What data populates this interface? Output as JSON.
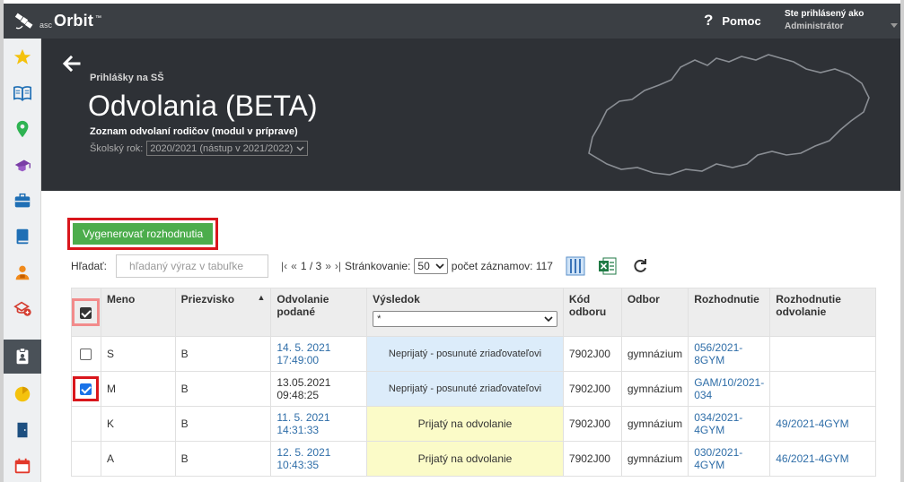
{
  "app": {
    "logo_small": "asc",
    "logo_text": "Orbit",
    "logo_tm": "™",
    "help_label": "Pomoc",
    "user_line1": "Ste prihlásený ako",
    "user_line2": "Administrátor"
  },
  "sidebar": {
    "items": [
      {
        "icon": "star-icon"
      },
      {
        "icon": "book-open-icon"
      },
      {
        "icon": "location-pin-icon"
      },
      {
        "icon": "graduation-cap-icon"
      },
      {
        "icon": "briefcase-icon"
      },
      {
        "icon": "book-icon"
      },
      {
        "icon": "student-icon"
      },
      {
        "icon": "school-add-icon"
      },
      {
        "icon": "clipboard-user-icon",
        "active": true
      },
      {
        "icon": "pie-chart-icon"
      },
      {
        "icon": "door-icon"
      },
      {
        "icon": "calendar-icon"
      }
    ]
  },
  "header": {
    "breadcrumb": "Prihlášky na SŠ",
    "title": "Odvolania (BETA)",
    "subtitle": "Zoznam odvolaní rodičov (modul v príprave)",
    "year_label": "Školský rok:",
    "year_value": "2020/2021 (nástup v 2021/2022)"
  },
  "toolbar": {
    "generate_label": "Vygenerovať rozhodnutia",
    "search_label": "Hľadať:",
    "search_placeholder": "hľadaný výraz v tabuľke",
    "pager_first": "|‹",
    "pager_prev": "«",
    "pager_current": "1 / 3",
    "pager_next": "»",
    "pager_last": "›|",
    "paging_label": "Stránkovanie:",
    "page_size": "50",
    "count_label": "počet záznamov: 117"
  },
  "table": {
    "headers": {
      "name": "Meno",
      "surname": "Priezvisko",
      "submitted": "Odvolanie podané",
      "result": "Výsledok",
      "result_filter": "*",
      "code": "Kód odboru",
      "field": "Odbor",
      "decision": "Rozhodnutie",
      "appeal_decision": "Rozhodnutie odvolanie"
    },
    "rows": [
      {
        "checked": false,
        "name": "S",
        "surname": "B",
        "submitted": "14. 5. 2021 17:49:00",
        "submitted_link": true,
        "result": "Neprijatý - posunuté zriaďovateľovi",
        "result_color": "blue",
        "code": "7902J00",
        "field": "gymnázium",
        "decision": "056/2021-8GYM",
        "appeal_decision": ""
      },
      {
        "checked": true,
        "name": "M",
        "surname": "B",
        "submitted": "13.05.2021 09:48:25",
        "submitted_link": false,
        "result": "Neprijatý - posunuté zriaďovateľovi",
        "result_color": "blue",
        "code": "7902J00",
        "field": "gymnázium",
        "decision": "GAM/10/2021-034",
        "appeal_decision": ""
      },
      {
        "checked": null,
        "name": "K",
        "surname": "B",
        "submitted": "11. 5. 2021 14:31:33",
        "submitted_link": true,
        "result": "Prijatý na odvolanie",
        "result_color": "yellow",
        "code": "7902J00",
        "field": "gymnázium",
        "decision": "034/2021-4GYM",
        "appeal_decision": "49/2021-4GYM"
      },
      {
        "checked": null,
        "name": "A",
        "surname": "B",
        "submitted": "12. 5. 2021 10:43:35",
        "submitted_link": true,
        "result": "Prijatý na odvolanie",
        "result_color": "yellow",
        "code": "7902J00",
        "field": "gymnázium",
        "decision": "030/2021-4GYM",
        "appeal_decision": "46/2021-4GYM"
      }
    ]
  },
  "colors": {
    "topbar": "#3b3f44",
    "hero": "#2e3136",
    "accent_green": "#4cad4c",
    "highlight_red": "#d9161c",
    "link_blue": "#2f6ea8",
    "result_blue": "#dcecfa",
    "result_yellow": "#fbfbc8"
  }
}
